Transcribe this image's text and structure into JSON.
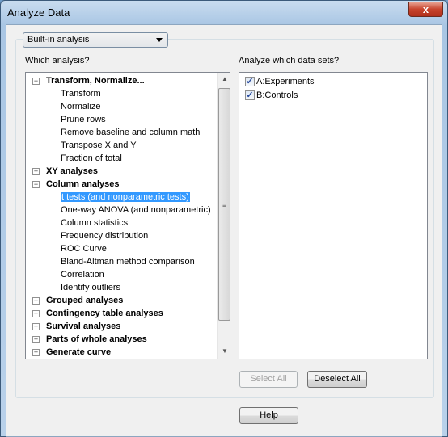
{
  "window": {
    "title": "Analyze Data",
    "close_label": "x"
  },
  "dropdown": {
    "value": "Built-in analysis"
  },
  "labels": {
    "which_analysis": "Which analysis?",
    "which_datasets": "Analyze which data sets?"
  },
  "tree": [
    {
      "label": "Transform, Normalize...",
      "level": 0,
      "expander": "minus"
    },
    {
      "label": "Transform",
      "level": 1
    },
    {
      "label": "Normalize",
      "level": 1
    },
    {
      "label": "Prune rows",
      "level": 1
    },
    {
      "label": "Remove baseline and column math",
      "level": 1
    },
    {
      "label": "Transpose X and Y",
      "level": 1
    },
    {
      "label": "Fraction of total",
      "level": 1
    },
    {
      "label": "XY analyses",
      "level": 0,
      "expander": "plus"
    },
    {
      "label": "Column analyses",
      "level": 0,
      "expander": "minus"
    },
    {
      "label": "t tests (and nonparametric tests)",
      "level": 1,
      "selected": true
    },
    {
      "label": "One-way ANOVA (and nonparametric)",
      "level": 1
    },
    {
      "label": "Column statistics",
      "level": 1
    },
    {
      "label": "Frequency distribution",
      "level": 1
    },
    {
      "label": "ROC Curve",
      "level": 1
    },
    {
      "label": "Bland-Altman method comparison",
      "level": 1
    },
    {
      "label": "Correlation",
      "level": 1
    },
    {
      "label": "Identify outliers",
      "level": 1
    },
    {
      "label": "Grouped analyses",
      "level": 0,
      "expander": "plus"
    },
    {
      "label": "Contingency table analyses",
      "level": 0,
      "expander": "plus"
    },
    {
      "label": "Survival analyses",
      "level": 0,
      "expander": "plus"
    },
    {
      "label": "Parts of whole analyses",
      "level": 0,
      "expander": "plus"
    },
    {
      "label": "Generate curve",
      "level": 0,
      "expander": "plus"
    }
  ],
  "datasets": [
    {
      "label": "A:Experiments",
      "checked": true
    },
    {
      "label": "B:Controls",
      "checked": true
    }
  ],
  "buttons": {
    "select_all": "Select All",
    "deselect_all": "Deselect All",
    "help": "Help"
  },
  "colors": {
    "selection": "#3399ff"
  }
}
